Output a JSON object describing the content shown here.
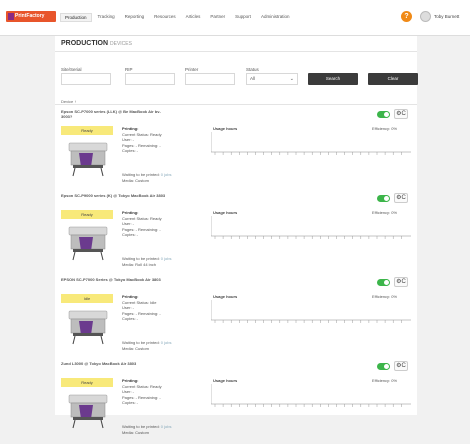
{
  "app": {
    "logo_text": "PrintFactory",
    "nav": [
      "Production",
      "Tracking",
      "Reporting",
      "Resources",
      "Articles",
      "Partner",
      "Support",
      "Administration"
    ],
    "user_name": "Toby Burnett"
  },
  "page": {
    "title": "PRODUCTION",
    "subtitle": "DEVICES"
  },
  "filters": {
    "site_label": "Site/Serial",
    "rip_label": "RIP",
    "printer_label": "Printer",
    "status_label": "Status",
    "status_value": "All",
    "search_label": "Search",
    "clear_label": "Clear"
  },
  "sort_label": "Device ↑",
  "card_labels": {
    "printing": "Printing:",
    "user": "User: -",
    "pages": "Pages: -    Remaining: -",
    "copies": "Copies: -",
    "waiting": "Waiting to be printed:",
    "usage": "Usage hours",
    "settings_icon": "⚙C"
  },
  "devices": [
    {
      "name": "Epson SC-P7000 series (LLK) @ Be MacBook Air bv-3003?",
      "status": "Ready",
      "current_status": "Current Status: Ready",
      "jobs": "0 jobs",
      "media": "Media: Custom",
      "efficiency": "Efficiency: 0%"
    },
    {
      "name": "Epson SC-P9000 series (K) @ Tokyo MacBook Air 3803",
      "status": "Ready",
      "current_status": "Current Status: Ready",
      "jobs": "0 jobs",
      "media": "Media: Roll 44 inch",
      "efficiency": "Efficiency: 0%"
    },
    {
      "name": "EPSON SC-P7000 Series @ Tokyo MacBook Air 3803",
      "status": "Idle",
      "current_status": "Current Status: Idle",
      "jobs": "0 jobs",
      "media": "Media: Custom",
      "efficiency": "Efficiency: 0%"
    },
    {
      "name": "Zund L3000 @ Tokyo MacBook Air 3803",
      "status": "Ready",
      "current_status": "Current Status: Ready",
      "jobs": "0 jobs",
      "media": "Media: Custom",
      "efficiency": "Efficiency: 0%"
    }
  ],
  "colors": {
    "accent": "#e8552b",
    "toggle_on": "#3cb54a",
    "status_badge": "#f8e97a",
    "button": "#3b3b3b",
    "help": "#f08a17"
  },
  "icons": {
    "help": "help-icon",
    "avatar": "user-avatar-icon",
    "settings": "settings-icon",
    "toggle": "toggle-icon"
  }
}
